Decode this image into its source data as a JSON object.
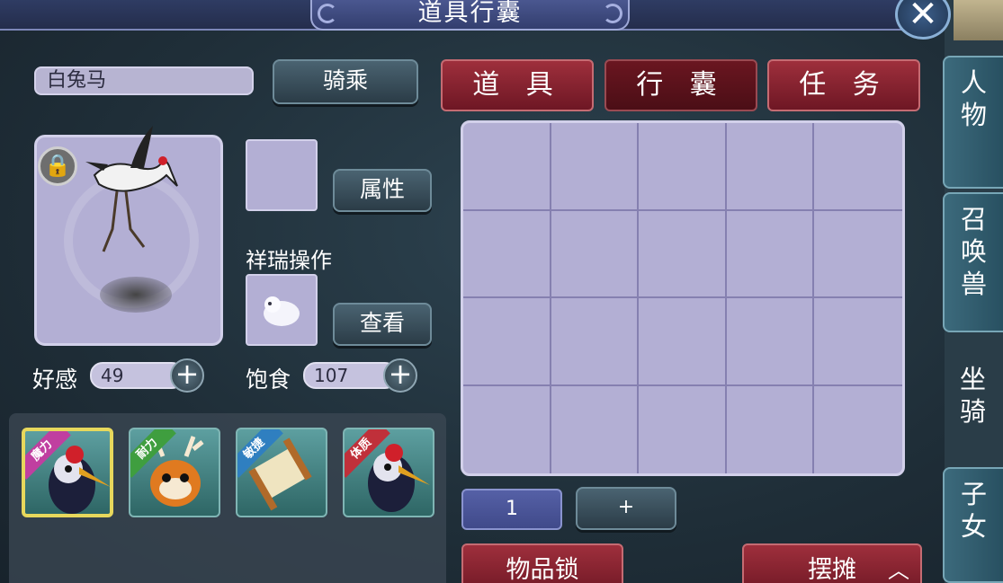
{
  "window": {
    "title": "道具行囊",
    "close_icon": "close-icon"
  },
  "mount": {
    "name": "白兔马",
    "ride_label": "骑乘",
    "attr_label": "属性",
    "luck_title": "祥瑞操作",
    "view_label": "查看",
    "favor_label": "好感",
    "favor_value": "49",
    "food_label": "饱食",
    "food_value": "107"
  },
  "tabs": [
    {
      "label": "道 具",
      "active": false
    },
    {
      "label": "行 囊",
      "active": true
    },
    {
      "label": "任 务",
      "active": false
    }
  ],
  "mount_list": [
    {
      "tag": "魔力",
      "tag_color": "#c03fa0",
      "icon": "crane-mount-icon",
      "selected": true
    },
    {
      "tag": "耐力",
      "tag_color": "#3f9e3f",
      "icon": "deer-mount-icon",
      "selected": false
    },
    {
      "tag": "敏捷",
      "tag_color": "#2f7fc0",
      "icon": "scroll-mount-icon",
      "selected": false
    },
    {
      "tag": "体质",
      "tag_color": "#c0303a",
      "icon": "crane-mount-icon",
      "selected": false
    }
  ],
  "inventory": {
    "rows": 4,
    "cols": 5,
    "quantity": "1",
    "plus_label": "+"
  },
  "bottom": {
    "item_lock_label": "物品锁",
    "stall_label": "摆摊",
    "stall_arrow_icon": "chevron-up-icon"
  },
  "side_tabs": [
    {
      "label": "人物",
      "active": false
    },
    {
      "label": "召唤兽",
      "active": false
    },
    {
      "label": "坐骑",
      "active": true
    },
    {
      "label": "子女",
      "active": false
    }
  ],
  "colors": {
    "accent_red": "#9e2f3c",
    "slot_lavender": "#b3afd4",
    "panel_dark": "#1f2e38"
  }
}
